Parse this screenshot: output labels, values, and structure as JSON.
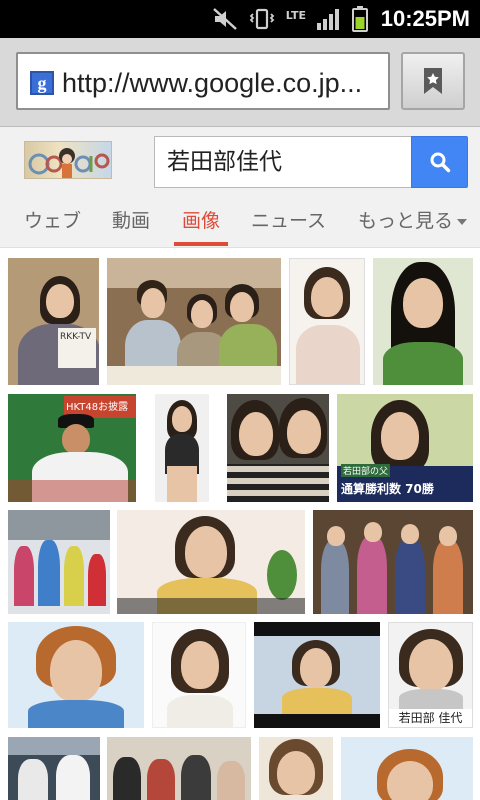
{
  "status_bar": {
    "time": "10:25PM",
    "network_label": "LTE",
    "icons": [
      "mute-icon",
      "vibrate-icon",
      "lte-icon",
      "signal-icon",
      "battery-icon"
    ]
  },
  "address_bar": {
    "url": "http://www.google.co.jp...",
    "favicon_letter": "g",
    "bookmark_icon": "bookmark-icon"
  },
  "search": {
    "logo": "google-doodle",
    "query": "若田部佳代",
    "button_icon": "search-icon",
    "accent_color": "#4285f4"
  },
  "tabs": [
    {
      "label": "ウェブ",
      "active": false
    },
    {
      "label": "動画",
      "active": false
    },
    {
      "label": "画像",
      "active": true
    },
    {
      "label": "ニュース",
      "active": false
    },
    {
      "label": "もっと見る",
      "active": false
    }
  ],
  "active_tab_color": "#dd4b39",
  "results": {
    "captions": {
      "r1_1": "RKK-TV",
      "r2_1": "HKT48お披露",
      "r2_4": "通算勝利数 70勝",
      "r2_4_b": "若田部の父",
      "r4_4": "若田部 佳代"
    }
  }
}
